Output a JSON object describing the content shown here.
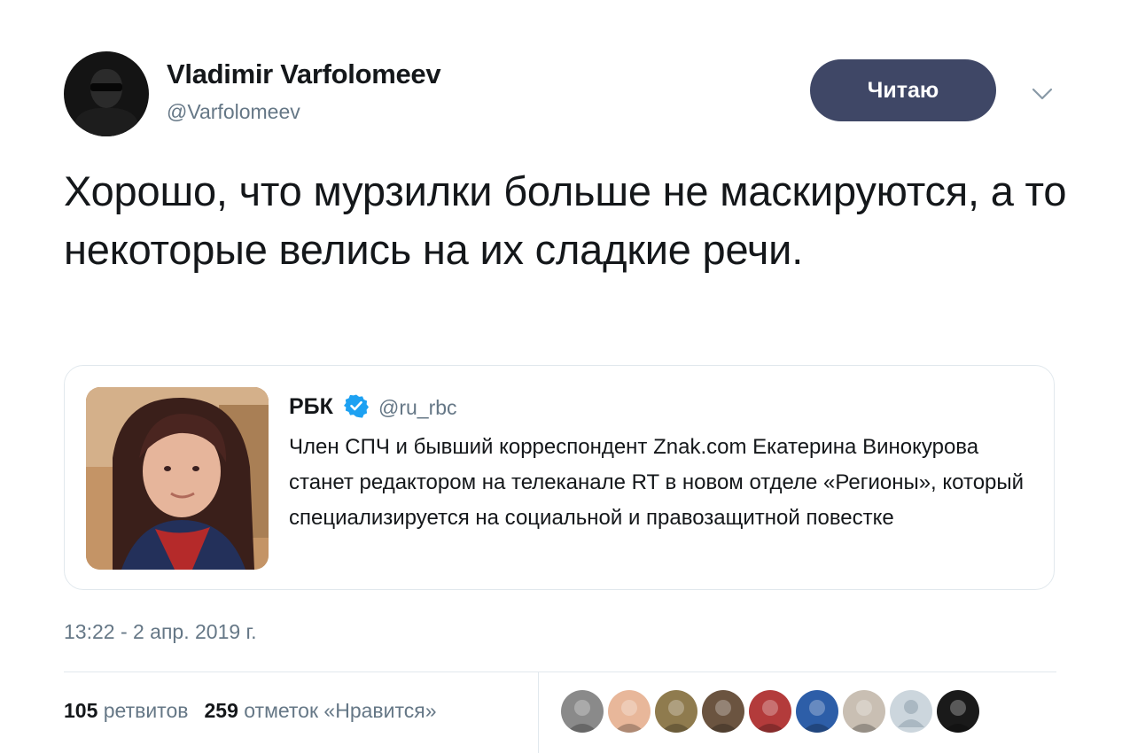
{
  "author": {
    "name": "Vladimir Varfolomeev",
    "handle": "@Varfolomeev",
    "avatar_icon": "user-avatar-photo"
  },
  "follow_button": {
    "label": "Читаю",
    "color": "#3f4766"
  },
  "caret_icon": "chevron-down-icon",
  "tweet": {
    "text": "Хорошо, что мурзилки больше не маскируются, а то некоторые велись на их сладкие речи."
  },
  "quoted_tweet": {
    "name": "РБК",
    "verified_icon": "verified-badge-icon",
    "handle": "@ru_rbc",
    "text": "Член СПЧ и бывший корреспондент Znak.com Екатерина Винокурова станет редактором на телеканале RT в новом отделе «Регионы», который специализируется на социальной и правозащитной повестке"
  },
  "timestamp": "13:22 - 2 апр. 2019 г.",
  "stats": {
    "retweets_count": "105",
    "retweets_label": "ретвитов",
    "likes_count": "259",
    "likes_label": "отметок «Нравится»"
  },
  "likers": [
    {
      "icon": "liker-avatar-icon",
      "color": "#8a8a8a"
    },
    {
      "icon": "liker-avatar-icon",
      "color": "#e8b79a"
    },
    {
      "icon": "liker-avatar-icon",
      "color": "#8f7b4e"
    },
    {
      "icon": "liker-avatar-icon",
      "color": "#6b5440"
    },
    {
      "icon": "liker-avatar-icon",
      "color": "#b33b3b"
    },
    {
      "icon": "liker-avatar-icon",
      "color": "#2d5ea8"
    },
    {
      "icon": "liker-avatar-icon",
      "color": "#c9bfb3"
    },
    {
      "icon": "default-avatar-icon",
      "color": "#ccd6dd"
    },
    {
      "icon": "liker-avatar-icon",
      "color": "#1a1a1a"
    }
  ],
  "colors": {
    "text": "#14171a",
    "secondary": "#657786",
    "border": "#e1e8ed",
    "verified": "#1da1f2"
  }
}
